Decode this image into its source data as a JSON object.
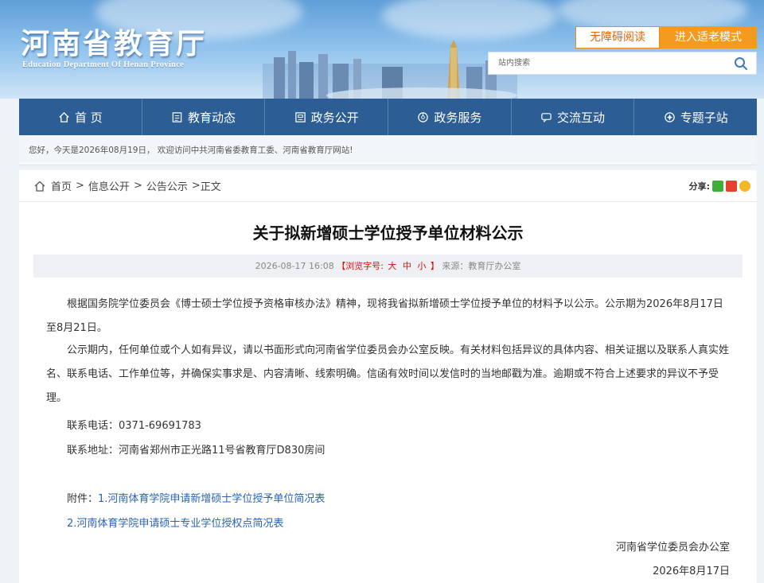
{
  "header": {
    "title_cn": "河南省教育厅",
    "title_en": "Education Department Of Henan Province",
    "accessibility_label": "无障碍阅读",
    "elder_mode_label": "进入适老模式",
    "search_placeholder": "站内搜索"
  },
  "nav": [
    {
      "label": "首 页",
      "icon": "home-icon"
    },
    {
      "label": "教育动态",
      "icon": "news-icon"
    },
    {
      "label": "政务公开",
      "icon": "document-icon"
    },
    {
      "label": "政务服务",
      "icon": "service-icon"
    },
    {
      "label": "交流互动",
      "icon": "chat-icon"
    },
    {
      "label": "专题子站",
      "icon": "topic-icon"
    }
  ],
  "welcome": "您好，今天是2026年08月19日， 欢迎访问中共河南省委教育工委、河南省教育厅网站!",
  "breadcrumb": {
    "items": [
      "首页",
      "信息公开",
      "公告公示"
    ],
    "current": "正文",
    "share_label": "分享:"
  },
  "article": {
    "title": "关于拟新增硕士学位授予单位材料公示",
    "date": "2026-08-17 16:08",
    "font_size_label": "【浏览字号:",
    "font_sizes": [
      "大",
      "中",
      "小"
    ],
    "font_size_end": "】",
    "source": "来源：教育厅办公室",
    "para1": "根据国务院学位委员会《博士硕士学位授予资格审核办法》精神，现将我省拟新增硕士学位授予单位的材料予以公示。公示期为2026年8月17日至8月21日。",
    "para2": "公示期内，任何单位或个人如有异议，请以书面形式向河南省学位委员会办公室反映。有关材料包括异议的具体内容、相关证据以及联系人真实姓名、联系电话、工作单位等，并确保实事求是、内容清晰、线索明确。信函有效时间以发信时的当地邮戳为准。逾期或不符合上述要求的异议不予受理。",
    "phone": "联系电话：0371-69691783",
    "address": "联系地址：河南省郑州市正光路11号省教育厅D830房间",
    "attachment_label": "附件：",
    "attachments": [
      "1.河南体育学院申请新增硕士学位授予单位简况表",
      "2.河南体育学院申请硕士专业学位授权点简况表"
    ],
    "signature": "河南省学位委员会办公室",
    "sign_date": "2026年8月17日"
  },
  "colors": {
    "nav_bg": "#2d5d95",
    "accent_orange": "#f39a1f",
    "link_blue": "#2a63b8",
    "meta_red": "#d40f0f"
  }
}
